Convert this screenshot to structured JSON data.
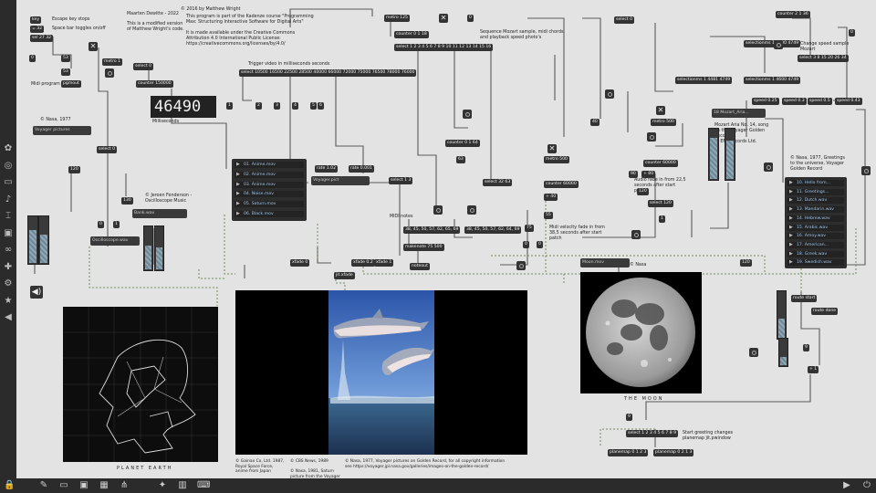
{
  "toolbar_left": {
    "icons": [
      "apps-icon",
      "target-icon",
      "presentation-icon",
      "music-note-icon",
      "bracket-icon",
      "image-icon",
      "link-icon",
      "puzzle-icon",
      "gear-icon",
      "star-icon",
      "speaker-icon"
    ]
  },
  "toolbar_bottom": {
    "icons": [
      "lock-icon",
      "edit-icon",
      "chat-icon",
      "window-icon",
      "grid-icon",
      "hierarchy-icon",
      "wrench-icon",
      "piano-icon",
      "keyboard-icon",
      "play-icon",
      "power-icon"
    ]
  },
  "notes": {
    "credit_top": "Maarten Dewitte - 2022",
    "credit_modified": "This is a modified version\nof Matthew Wright's code.",
    "copyright": "© 2016 by Matthew Wright",
    "license": "This program is part of the Kadenze course \"Programming\nMax: Structuring Interactive Software for Digital Arts\"\n\nIt is made available under the Creative Commons\nAttribution 4.0 International Public License:\nhttps://creativecommons.org/licenses/by/4.0/",
    "escape": "Escape key stops",
    "spacebar": "Space bar toggles on/off",
    "midi_program": "Midi program",
    "nasa_1977": "© Nasa, 1977",
    "trigger": "Trigger video in milliseconds seconds",
    "milliseconds": "Milliseconds",
    "sequence": "Sequence Mozart sample, midi chords\nand playback speed photo's",
    "change_speed": "Change speed sample\nMozart",
    "mozart_aria": "Mozart Aria No. 14, song\non the Voyager Golden\nRecord\n© EMI Records Ltd.",
    "greetings": "© Nasa, 1977, Greetings\nto the universe, Voyager\nGolden Record",
    "audio_fade": "Audio fade in from 22,5\nseconds after start\npatch",
    "jeroen": "© Jeroen Fenderson -\nOscilloscope Music",
    "midi_notes": "MIDI notes",
    "midi_velocity": "Midi velocity fade in from\n38,5 seconds after start\npatch",
    "start_greeting": "Start greeting changes\nplanemap jit.pwindow",
    "nasa_moon": "© Nasa"
  },
  "big_number": "46490",
  "objects": {
    "key": "key",
    "sel32": "= 32",
    "sel2732": "sel 27 32",
    "n0a": "0",
    "n53": "53",
    "n53b": "53",
    "pgmout": "pgmout",
    "metro1": "metro 1",
    "sel0a": "select 0",
    "counter150000": "counter 150000",
    "metro125": "metro 125",
    "counter018": "counter 0 1 18",
    "sel_seq": "select 1 2 3 4 5 6 7 8 9 10 11 12 13 14 15 16",
    "trigger_sel": "select 10500 16500 22500 28500 40000 66000 72000 75000 76500 78000 76000",
    "n1": "1",
    "n2": "2",
    "n3": "3",
    "n4": "4",
    "n5": "5",
    "n6": "6",
    "n1b": "1",
    "n1c": "1",
    "n0c": "0",
    "counter0164": "counter 0 1 64",
    "n63": "63",
    "sel13": "select 1 3",
    "sel3263": "select 32 63",
    "n38a": "38, 45, 50, 57, 62, 65, 69",
    "n38b": "38, 45, 50, 57, 62, 64, 69",
    "makenote": "makenote 75 500",
    "noteout": "noteout",
    "xfade0": "xfade 0",
    "xfade02": "xfade 0.2",
    "xfade1": "xfade 1",
    "jitxfade": "jit.xfade",
    "rate1": "rate 1.02",
    "rate0001": "rate 0.001",
    "n120": "120",
    "n130": "130",
    "sel0b": "select 0",
    "n0d": "0",
    "n1d": "1",
    "metro500": "metro 500",
    "metro500b": "metro 500",
    "counter60000": "counter 60000",
    "counter60000b": "counter 60000",
    "n40": "40",
    "n90": "90",
    "n80": "+ 80",
    "n120b": "120",
    "sel120": "select 120",
    "n1e": "1",
    "n55": "55",
    "n40b": "+ 40",
    "selectionms": "selectionms 1 4400 4749",
    "selectionms2": "selectionms 1 4600 4749",
    "selectionms3": "selectionms 1 4481 4749",
    "counter2136": "counter 2 1 36",
    "n0e": "0",
    "sel_speed": "select 3 8 15 20 26 34",
    "speed025": "speed 0.25",
    "speed03": "speed 0.3",
    "speed05": "speed 0.5",
    "speed043": "speed 0.43",
    "sel0c": "select 0",
    "n75": "75",
    "n0f": "0",
    "n0g": "0",
    "n55b": "55",
    "n120c": "120",
    "routestart": "route start",
    "routedone": "route done",
    "n9": "9",
    "n1f": "1",
    "plus1": "+ 1",
    "n9b": "9",
    "sel_pm": "select 1 2 3 4 5 6 7 8 9",
    "planemap0123": "planemap 0 1 2 3",
    "planemap0213": "planemap 0 2 1 3",
    "sfplay": "18 Mozart_Aria...",
    "moonvid": "Moon.mov",
    "dolvid": "Voyager.pict",
    "bankvid": "Bank.wav",
    "voyager": "Voyager pictures",
    "sync": "Oscilloscope.wav"
  },
  "playlist_movies": [
    {
      "label": "01. Anime.mov"
    },
    {
      "label": "02. Anime.mov"
    },
    {
      "label": "03. Anime.mov"
    },
    {
      "label": "04. Noise.mov"
    },
    {
      "label": "05. Saturn.mov"
    },
    {
      "label": "06. Black.mov"
    }
  ],
  "playlist_audio": [
    {
      "label": "10. Hello from..."
    },
    {
      "label": "11. Greetings..."
    },
    {
      "label": "12. Dutch.wav"
    },
    {
      "label": "13. Mandarin.wav"
    },
    {
      "label": "14. Hebrew.wav"
    },
    {
      "label": "15. Arabic.wav"
    },
    {
      "label": "16. Amoy.wav"
    },
    {
      "label": "17. American..."
    },
    {
      "label": "18. Greek.wav"
    },
    {
      "label": "19. Swedish.wav"
    }
  ],
  "captions": {
    "earth": "PLANET EARTH",
    "moon": "THE MOON"
  },
  "credits": {
    "c1": "© Gainax Co, Ltd. 1987,\nRoyal Space Force,\nanime from Japan",
    "c2": "© CBS News, 1989\n\n© Nasa, 1981, Saturn\npicture from the Voyager",
    "c3": "© Nasa, 1977, Voyager pictures on Golden Record, for all copyright information\nsee https://voyager.jpl.nasa.gov/galleries/images-on-the-golden-record/"
  }
}
